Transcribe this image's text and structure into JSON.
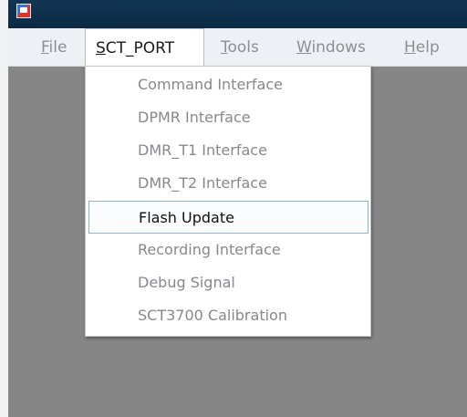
{
  "menu": {
    "items": [
      {
        "label": "File"
      },
      {
        "label": "SCT_PORT"
      },
      {
        "label": "Tools"
      },
      {
        "label": "Windows"
      },
      {
        "label": "Help"
      }
    ],
    "active_index": 1
  },
  "dropdown": {
    "items": [
      {
        "label": "Command Interface"
      },
      {
        "label": "DPMR Interface"
      },
      {
        "label": "DMR_T1 Interface"
      },
      {
        "label": "DMR_T2 Interface"
      },
      {
        "label": "Flash Update"
      },
      {
        "label": "Recording Interface"
      },
      {
        "label": "Debug Signal"
      },
      {
        "label": "SCT3700 Calibration"
      }
    ],
    "highlighted_index": 4
  },
  "colors": {
    "title_bar": "#123552",
    "menu_bar": "#eef0f5",
    "desktop": "#868686",
    "disabled_text": "#85888d",
    "highlight_border": "#8fb3cf"
  }
}
